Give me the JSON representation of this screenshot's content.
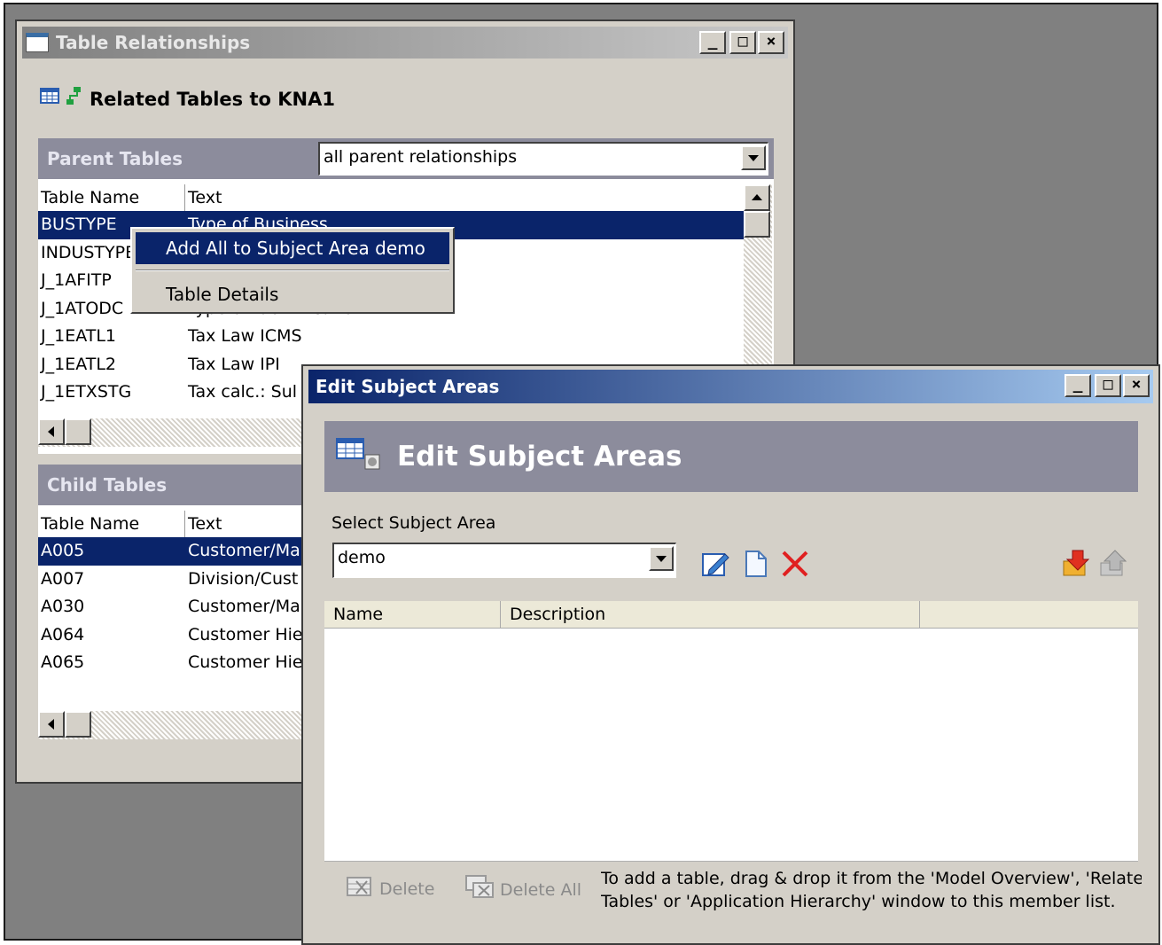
{
  "rel_window": {
    "title": "Table Relationships",
    "heading": "Related Tables to KNA1",
    "parent": {
      "header": "Parent Tables",
      "filter_value": "all parent relationships",
      "columns": [
        "Table Name",
        "Text"
      ],
      "rows": [
        {
          "name": "BUSTYPE",
          "text": "Type of Business"
        },
        {
          "name": "INDUSTYPE",
          "text": ""
        },
        {
          "name": "J_1AFITP",
          "text": ""
        },
        {
          "name": "J_1ATODC",
          "text": "Type of Identification"
        },
        {
          "name": "J_1EATL1",
          "text": "Tax Law ICMS"
        },
        {
          "name": "J_1EATL2",
          "text": "Tax Law IPI"
        },
        {
          "name": "J_1ETXSTG",
          "text": "Tax calc.: Sul"
        }
      ]
    },
    "child": {
      "header": "Child Tables",
      "columns": [
        "Table Name",
        "Text"
      ],
      "rows": [
        {
          "name": "A005",
          "text": "Customer/Ma"
        },
        {
          "name": "A007",
          "text": "Division/Cust"
        },
        {
          "name": "A030",
          "text": "Customer/Ma"
        },
        {
          "name": "A064",
          "text": "Customer Hie"
        },
        {
          "name": "A065",
          "text": "Customer Hie"
        }
      ]
    }
  },
  "context_menu": {
    "item1": "Add All to Subject Area demo",
    "item2": "Table Details"
  },
  "edit_window": {
    "title": "Edit Subject Areas",
    "heading": "Edit Subject Areas",
    "select_label": "Select Subject Area",
    "select_value": "demo",
    "columns": [
      "Name",
      "Description"
    ],
    "delete_label": "Delete",
    "delete_all_label": "Delete All",
    "hint": "To add a table, drag & drop it from the 'Model Overview', 'Related Tables' or 'Application Hierarchy' window to this member list.",
    "hint_line1": "To add a table, drag & drop it from the 'Model Overview', 'Relate",
    "hint_line2": "Tables' or 'Application Hierarchy'  window to this member list."
  },
  "window_buttons": {
    "minimize": "_",
    "maximize": "□",
    "close": "×"
  },
  "icons": [
    "table-icon",
    "relationship-icon",
    "edit-icon",
    "new-document-icon",
    "delete-x-icon",
    "import-icon",
    "export-icon"
  ],
  "colors": {
    "selection": "#0a246a",
    "active_title": "#0a246a",
    "panel_header": "#8c8c9c",
    "face": "#d4d0c8",
    "delete_red": "#e02020"
  }
}
